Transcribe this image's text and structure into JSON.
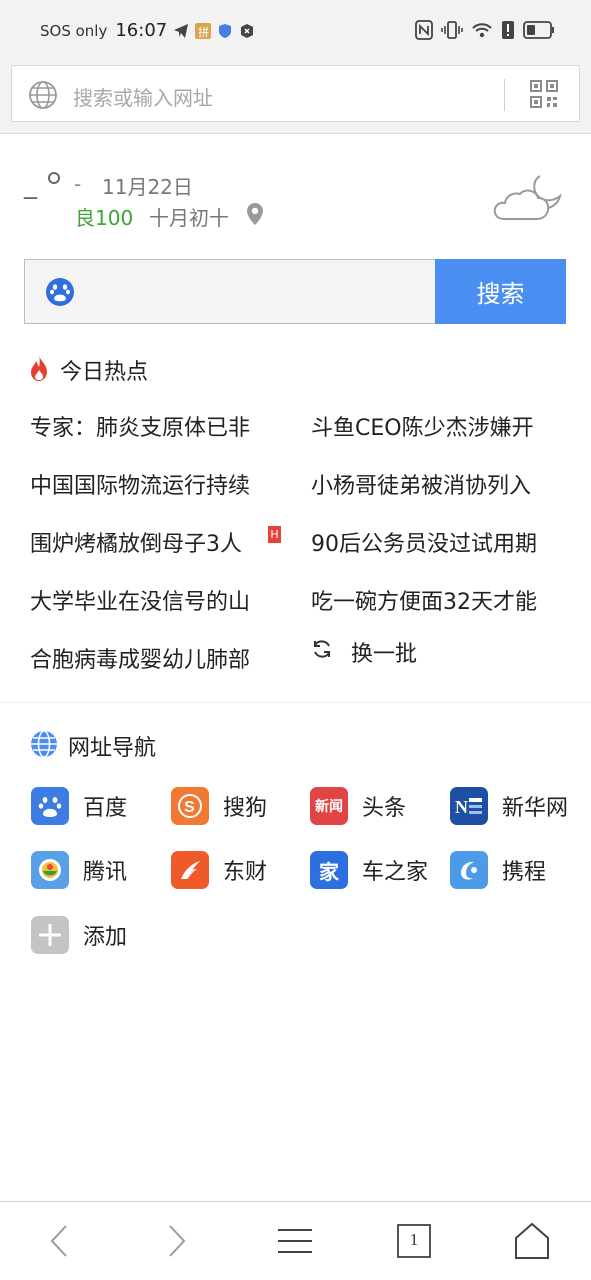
{
  "status_bar": {
    "carrier": "SOS only",
    "time": "16:07"
  },
  "address_bar": {
    "placeholder": "搜索或输入网址"
  },
  "weather": {
    "temp": "_",
    "dash": "-",
    "date": "11月22日",
    "aqi": "良100",
    "lunar_date": "十月初十"
  },
  "search": {
    "button_label": "搜索"
  },
  "hot": {
    "title": "今日热点",
    "items": [
      "专家：肺炎支原体已非",
      "斗鱼CEO陈少杰涉嫌开",
      "中国国际物流运行持续",
      "小杨哥徒弟被消协列入",
      "围炉烤橘放倒母子3人",
      "90后公务员没过试用期",
      "大学毕业在没信号的山",
      "吃一碗方便面32天才能",
      "合胞病毒成婴幼儿肺部"
    ],
    "badge": "H",
    "refresh_label": "换一批"
  },
  "nav": {
    "title": "网址导航",
    "items": [
      {
        "label": "百度",
        "icon": "baidu-icon",
        "color": "#3d7de3"
      },
      {
        "label": "搜狗",
        "icon": "sogou-icon",
        "color": "#f07a33"
      },
      {
        "label": "头条",
        "icon": "toutiao-icon",
        "color": "#e04444",
        "text": "新闻"
      },
      {
        "label": "新华网",
        "icon": "xinhua-icon",
        "color": "#1e4fa2"
      },
      {
        "label": "腾讯",
        "icon": "tencent-icon",
        "color": "#5aa0e6"
      },
      {
        "label": "东财",
        "icon": "dongcai-icon",
        "color": "#ef5a2a"
      },
      {
        "label": "车之家",
        "icon": "autohome-icon",
        "color": "#2e6fe0",
        "text": "家"
      },
      {
        "label": "携程",
        "icon": "ctrip-icon",
        "color": "#4d9be8"
      },
      {
        "label": "添加",
        "icon": "add-icon",
        "color": "#c4c4c4"
      }
    ]
  },
  "bottom": {
    "tab_count": "1"
  }
}
